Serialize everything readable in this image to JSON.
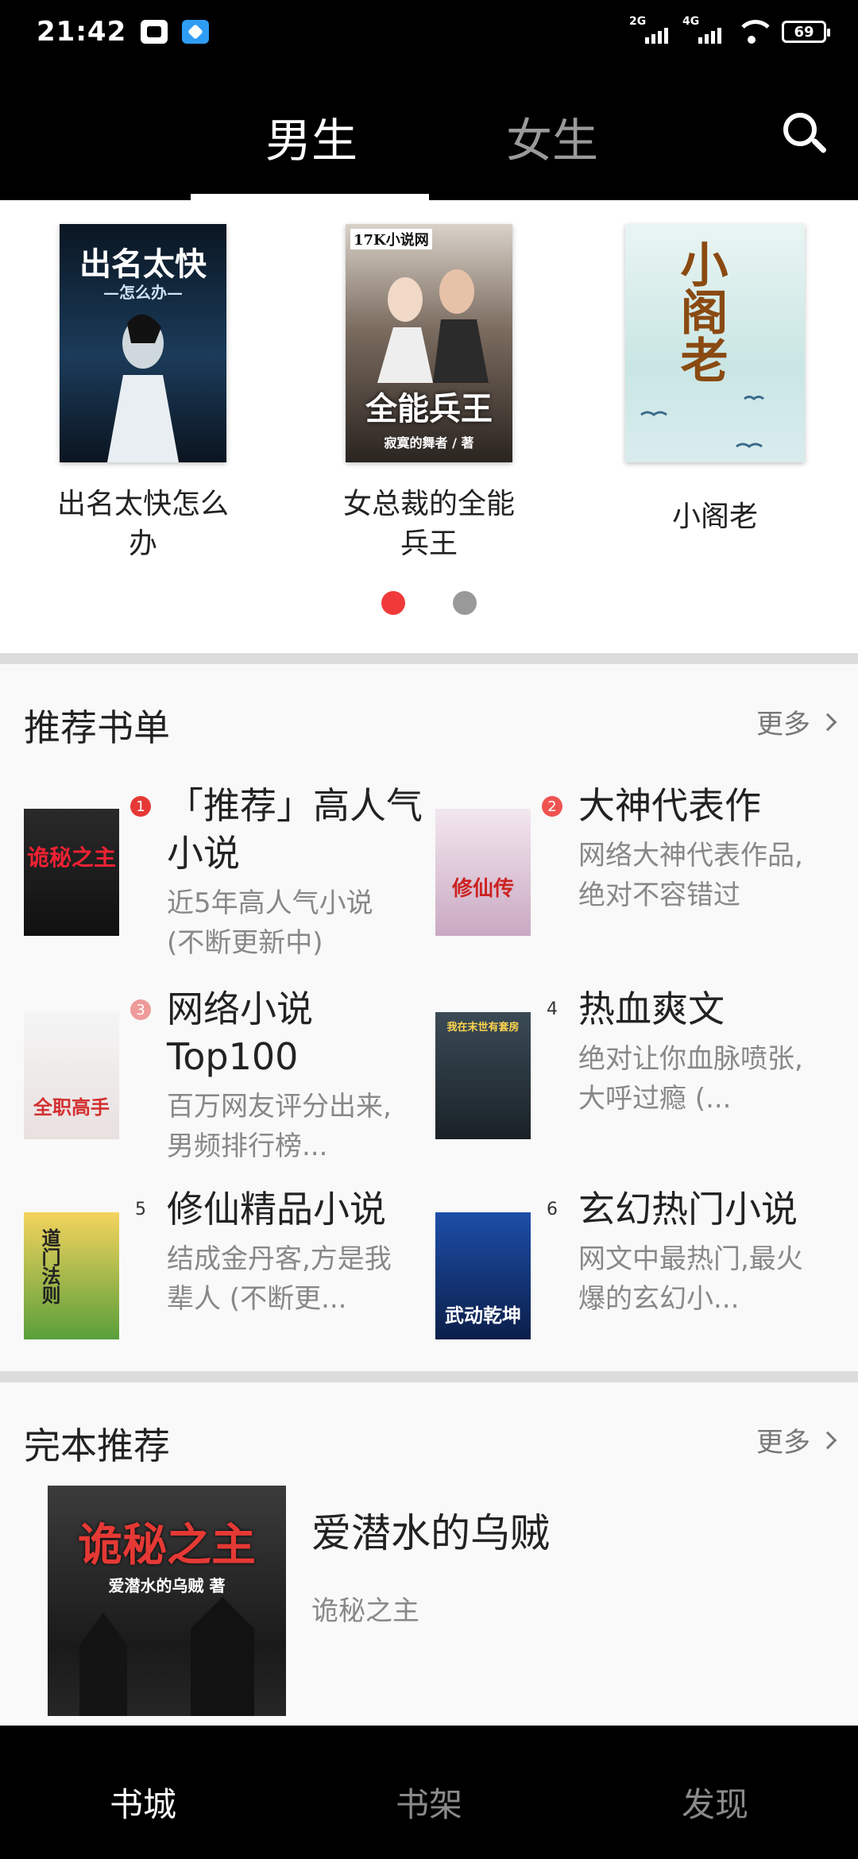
{
  "status_bar": {
    "time": "21:42",
    "net1": "2G",
    "net2": "4G",
    "battery": "69"
  },
  "tabs": {
    "male": "男生",
    "female": "女生"
  },
  "carousel": [
    {
      "title": "出名太快怎么办",
      "cover_text": "出名太快",
      "cover_sub": "—怎么办—"
    },
    {
      "title": "女总裁的全能兵王",
      "cover_text": "全能兵王",
      "cover_top": "17K小说网",
      "cover_sub": "寂寞的舞者 / 著"
    },
    {
      "title": "小阁老",
      "cover_text": "小阁老"
    }
  ],
  "recommend": {
    "title": "推荐书单",
    "more": "更多",
    "items": [
      {
        "rank": "1",
        "title": "「推荐」高人气小说",
        "desc": "近5年高人气小说(不断更新中)",
        "cover_text": "诡秘之主"
      },
      {
        "rank": "2",
        "title": "大神代表作",
        "desc": "网络大神代表作品,绝对不容错过",
        "cover_text": "修仙传"
      },
      {
        "rank": "3",
        "title": "网络小说Top100",
        "desc": "百万网友评分出来,男频排行榜...",
        "cover_text": "全职高手"
      },
      {
        "rank": "4",
        "title": "热血爽文",
        "desc": "绝对让你血脉喷张,大呼过瘾 (...",
        "cover_text": "我在末世有套房"
      },
      {
        "rank": "5",
        "title": "修仙精品小说",
        "desc": "结成金丹客,方是我辈人 (不断更...",
        "cover_text": "道门法则"
      },
      {
        "rank": "6",
        "title": "玄幻热门小说",
        "desc": "网文中最热门,最火爆的玄幻小...",
        "cover_text": "武动乾坤"
      }
    ]
  },
  "finished": {
    "title": "完本推荐",
    "more": "更多",
    "book": {
      "author": "爱潜水的乌贼",
      "name": "诡秘之主",
      "cover_text": "诡秘之主",
      "cover_sub": "爱潜水的乌贼 著"
    }
  },
  "bottom_nav": {
    "store": "书城",
    "shelf": "书架",
    "discover": "发现"
  }
}
